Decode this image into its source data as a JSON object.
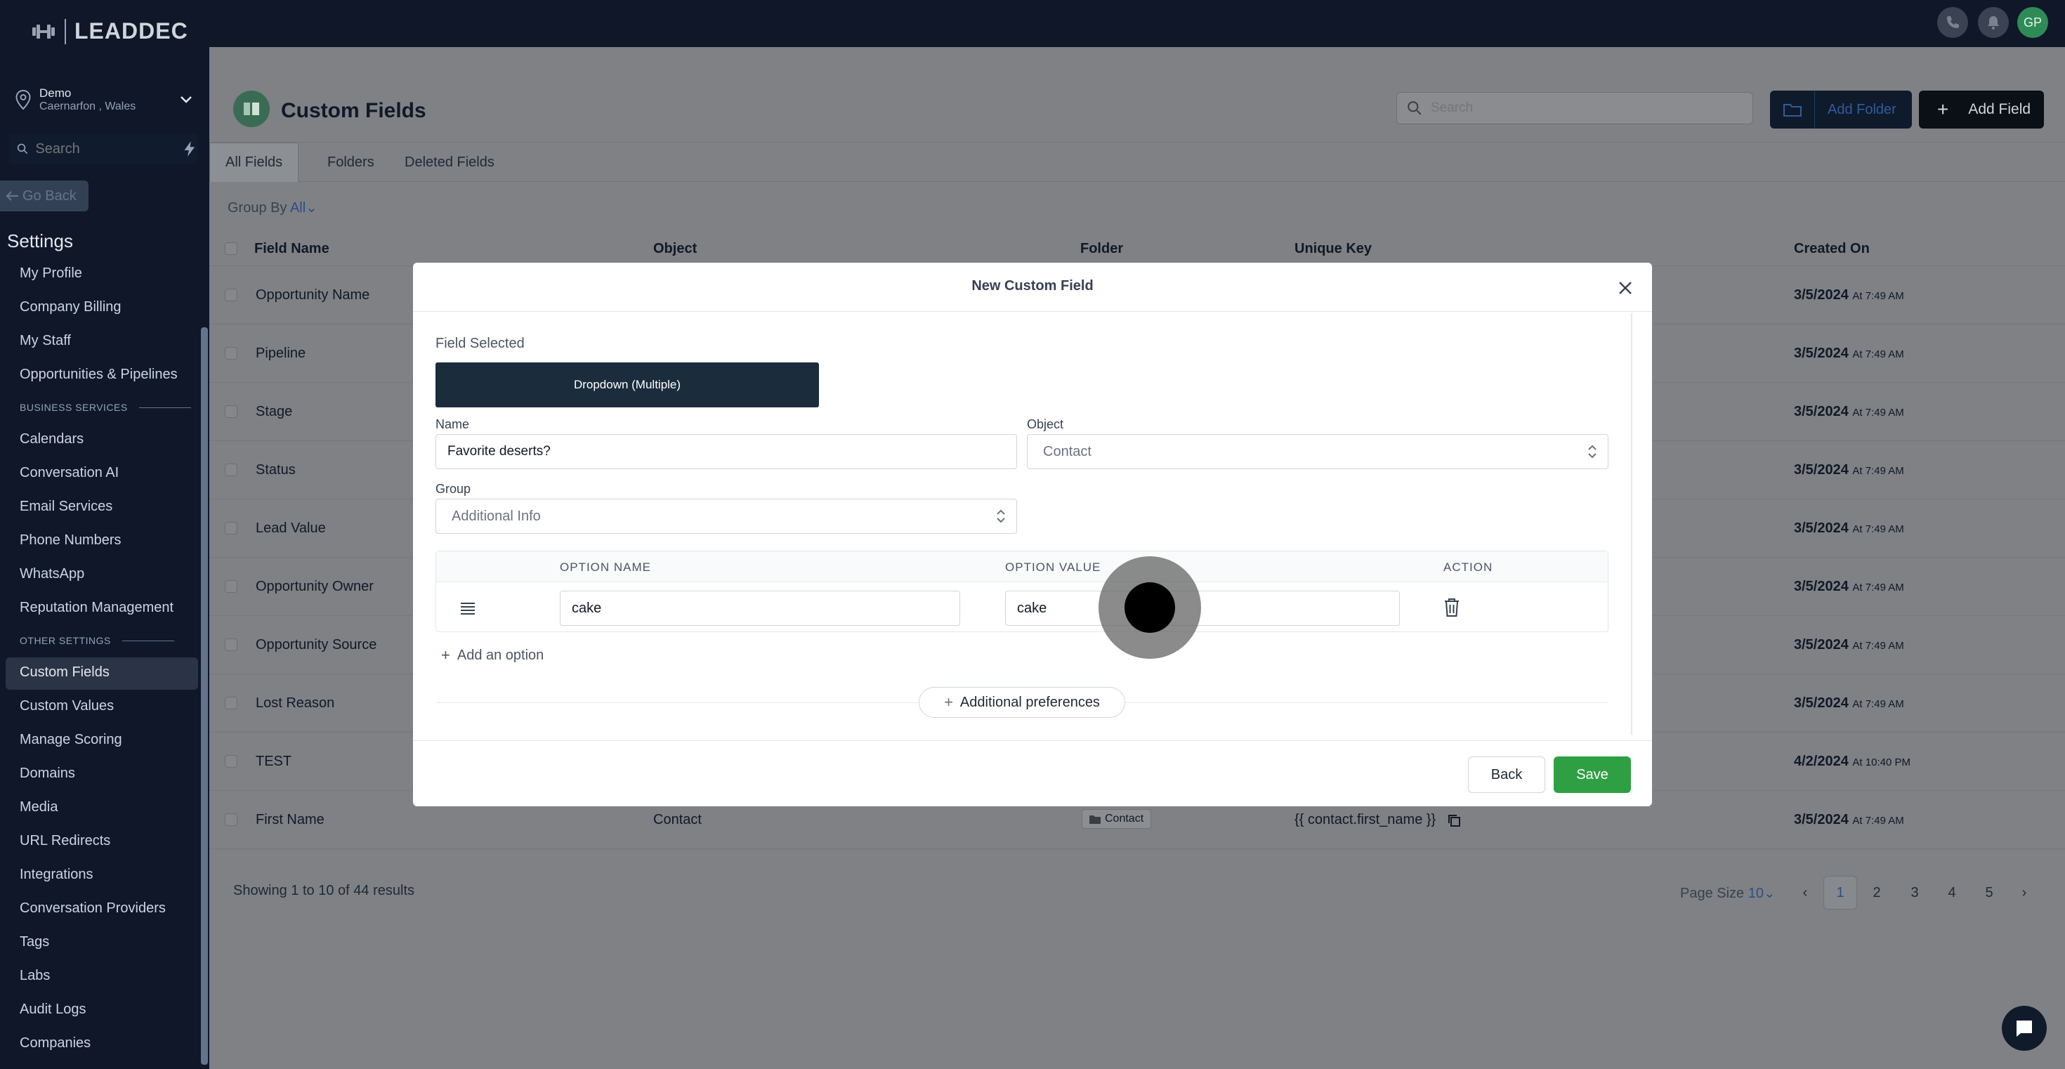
{
  "brand": {
    "name": "LEADDEC"
  },
  "location": {
    "name": "Demo",
    "address": "Caernarfon , Wales"
  },
  "sidebar": {
    "search_placeholder": "Search",
    "go_back": "Go Back",
    "settings_title": "Settings",
    "items_top": [
      "My Profile",
      "Company Billing",
      "My Staff",
      "Opportunities & Pipelines"
    ],
    "section_business": "BUSINESS SERVICES",
    "items_business": [
      "Calendars",
      "Conversation AI",
      "Email Services",
      "Phone Numbers",
      "WhatsApp",
      "Reputation Management"
    ],
    "section_other": "OTHER SETTINGS",
    "items_other": [
      "Custom Fields",
      "Custom Values",
      "Manage Scoring",
      "Domains",
      "Media",
      "URL Redirects",
      "Integrations",
      "Conversation Providers",
      "Tags",
      "Labs",
      "Audit Logs",
      "Companies"
    ]
  },
  "topbar": {
    "avatar_initials": "GP"
  },
  "page": {
    "title": "Custom Fields",
    "search_placeholder": "Search",
    "add_folder": "Add Folder",
    "add_field": "Add Field",
    "tabs": [
      "All Fields",
      "Folders",
      "Deleted Fields"
    ],
    "group_by_label": "Group By",
    "group_by_value": "All"
  },
  "table": {
    "headers": [
      "Field Name",
      "Object",
      "Folder",
      "Unique Key",
      "Created On"
    ],
    "rows": [
      {
        "name": "Opportunity Name",
        "date": "3/5/2024",
        "time": "At 7:49 AM"
      },
      {
        "name": "Pipeline",
        "date": "3/5/2024",
        "time": "At 7:49 AM"
      },
      {
        "name": "Stage",
        "date": "3/5/2024",
        "time": "At 7:49 AM"
      },
      {
        "name": "Status",
        "date": "3/5/2024",
        "time": "At 7:49 AM"
      },
      {
        "name": "Lead Value",
        "date": "3/5/2024",
        "time": "At 7:49 AM"
      },
      {
        "name": "Opportunity Owner",
        "date": "3/5/2024",
        "time": "At 7:49 AM"
      },
      {
        "name": "Opportunity Source",
        "date": "3/5/2024",
        "time": "At 7:49 AM"
      },
      {
        "name": "Lost Reason",
        "date": "3/5/2024",
        "time": "At 7:49 AM"
      },
      {
        "name": "TEST",
        "date": "4/2/2024",
        "time": "At 10:40 PM"
      },
      {
        "name": "First Name",
        "object": "Contact",
        "folder": "Contact",
        "key": "{{ contact.first_name }}",
        "date": "3/5/2024",
        "time": "At 7:49 AM"
      }
    ]
  },
  "pagination": {
    "showing_prefix": "Showing",
    "from": "1",
    "to_word": "to",
    "to": "10",
    "of_word": "of",
    "total": "44",
    "results_word": "results",
    "page_size_label": "Page Size",
    "page_size_value": "10",
    "pages": [
      "1",
      "2",
      "3",
      "4",
      "5"
    ]
  },
  "modal": {
    "title": "New Custom Field",
    "field_selected_label": "Field Selected",
    "field_type": "Dropdown (Multiple)",
    "name_label": "Name",
    "name_value": "Favorite deserts?",
    "object_label": "Object",
    "object_value": "Contact",
    "group_label": "Group",
    "group_value": "Additional Info",
    "options_headers": {
      "name": "OPTION NAME",
      "value": "OPTION VALUE",
      "action": "ACTION"
    },
    "options": [
      {
        "name": "cake",
        "value": "cake"
      }
    ],
    "add_option": "Add an option",
    "additional_preferences": "Additional preferences",
    "back": "Back",
    "save": "Save"
  },
  "colors": {
    "accent_blue": "#2b4f86",
    "save_green": "#2ea043",
    "dark_navy": "#0f1729"
  }
}
